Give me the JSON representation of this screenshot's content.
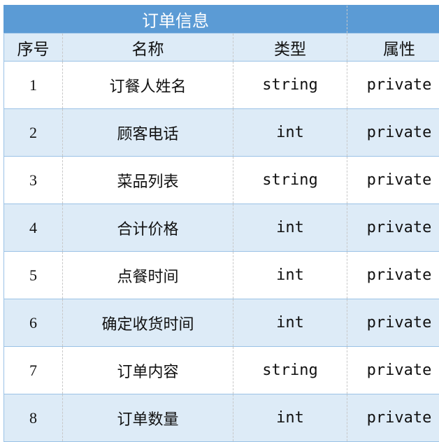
{
  "table": {
    "title": "订单信息",
    "colors": {
      "title_bg": "#5B9BD5",
      "header_bg": "#DDEBF7",
      "alt_row_bg": "#DDEBF7",
      "row_bg": "#FFFFFF",
      "border": "#9BC2E6"
    },
    "headers": {
      "index": "序号",
      "name": "名称",
      "type": "类型",
      "attribute": "属性"
    },
    "rows": [
      {
        "index": "1",
        "name": "订餐人姓名",
        "type": "string",
        "attribute": "private"
      },
      {
        "index": "2",
        "name": "顾客电话",
        "type": "int",
        "attribute": "private"
      },
      {
        "index": "3",
        "name": "菜品列表",
        "type": "string",
        "attribute": "private"
      },
      {
        "index": "4",
        "name": "合计价格",
        "type": "int",
        "attribute": "private"
      },
      {
        "index": "5",
        "name": "点餐时间",
        "type": "int",
        "attribute": "private"
      },
      {
        "index": "6",
        "name": "确定收货时间",
        "type": "int",
        "attribute": "private"
      },
      {
        "index": "7",
        "name": "订单内容",
        "type": "string",
        "attribute": "private"
      },
      {
        "index": "8",
        "name": "订单数量",
        "type": "int",
        "attribute": "private"
      }
    ]
  }
}
